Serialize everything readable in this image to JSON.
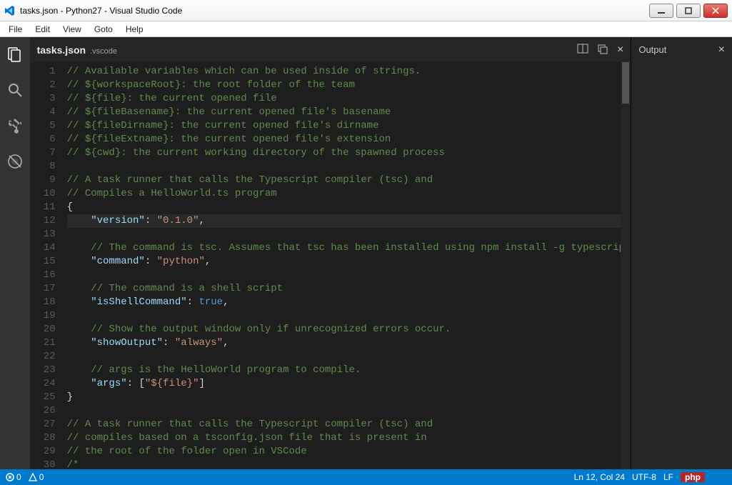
{
  "window": {
    "title": "tasks.json - Python27 - Visual Studio Code"
  },
  "menu": [
    "File",
    "Edit",
    "View",
    "Goto",
    "Help"
  ],
  "tab": {
    "filename": "tasks.json",
    "folder": ".vscode"
  },
  "output_panel": {
    "title": "Output"
  },
  "status": {
    "errors": "0",
    "warnings": "0",
    "cursor": "Ln 12, Col 24",
    "encoding": "UTF-8",
    "eol": "LF",
    "lang": "php"
  },
  "code_lines": [
    {
      "n": 1,
      "t": "comment",
      "text": "// Available variables which can be used inside of strings."
    },
    {
      "n": 2,
      "t": "comment",
      "text": "// ${workspaceRoot}: the root folder of the team"
    },
    {
      "n": 3,
      "t": "comment",
      "text": "// ${file}: the current opened file"
    },
    {
      "n": 4,
      "t": "comment",
      "text": "// ${fileBasename}: the current opened file's basename"
    },
    {
      "n": 5,
      "t": "comment",
      "text": "// ${fileDirname}: the current opened file's dirname"
    },
    {
      "n": 6,
      "t": "comment",
      "text": "// ${fileExtname}: the current opened file's extension"
    },
    {
      "n": 7,
      "t": "comment",
      "text": "// ${cwd}: the current working directory of the spawned process"
    },
    {
      "n": 8,
      "t": "blank",
      "text": ""
    },
    {
      "n": 9,
      "t": "comment",
      "text": "// A task runner that calls the Typescript compiler (tsc) and"
    },
    {
      "n": 10,
      "t": "comment",
      "text": "// Compiles a HelloWorld.ts program"
    },
    {
      "n": 11,
      "t": "brace",
      "text": "{"
    },
    {
      "n": 12,
      "t": "kv",
      "indent": "    ",
      "key": "\"version\"",
      "sep": ": ",
      "val": "\"0.1.0\"",
      "tail": ",",
      "hl": true
    },
    {
      "n": 13,
      "t": "blank",
      "text": ""
    },
    {
      "n": 14,
      "t": "comment",
      "indent": "    ",
      "text": "// The command is tsc. Assumes that tsc has been installed using npm install -g typescript"
    },
    {
      "n": 15,
      "t": "kv",
      "indent": "    ",
      "key": "\"command\"",
      "sep": ": ",
      "val": "\"python\"",
      "tail": ","
    },
    {
      "n": 16,
      "t": "blank",
      "text": ""
    },
    {
      "n": 17,
      "t": "comment",
      "indent": "    ",
      "text": "// The command is a shell script"
    },
    {
      "n": 18,
      "t": "kv",
      "indent": "    ",
      "key": "\"isShellCommand\"",
      "sep": ": ",
      "val": "true",
      "valtype": "bool",
      "tail": ","
    },
    {
      "n": 19,
      "t": "blank",
      "text": ""
    },
    {
      "n": 20,
      "t": "comment",
      "indent": "    ",
      "text": "// Show the output window only if unrecognized errors occur."
    },
    {
      "n": 21,
      "t": "kv",
      "indent": "    ",
      "key": "\"showOutput\"",
      "sep": ": ",
      "val": "\"always\"",
      "tail": ","
    },
    {
      "n": 22,
      "t": "blank",
      "text": ""
    },
    {
      "n": 23,
      "t": "comment",
      "indent": "    ",
      "text": "// args is the HelloWorld program to compile."
    },
    {
      "n": 24,
      "t": "kv",
      "indent": "    ",
      "key": "\"args\"",
      "sep": ": ",
      "pre": "[",
      "val": "\"${file}\"",
      "post": "]",
      "tail": ""
    },
    {
      "n": 25,
      "t": "brace",
      "text": "}"
    },
    {
      "n": 26,
      "t": "blank",
      "text": ""
    },
    {
      "n": 27,
      "t": "comment",
      "text": "// A task runner that calls the Typescript compiler (tsc) and"
    },
    {
      "n": 28,
      "t": "comment",
      "text": "// compiles based on a tsconfig.json file that is present in"
    },
    {
      "n": 29,
      "t": "comment",
      "text": "// the root of the folder open in VSCode"
    },
    {
      "n": 30,
      "t": "comment",
      "text": "/*"
    }
  ]
}
